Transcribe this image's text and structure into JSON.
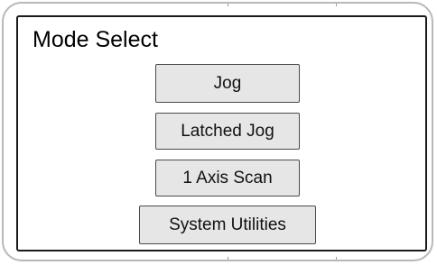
{
  "screen": {
    "title": "Mode Select"
  },
  "buttons": [
    {
      "label": "Jog"
    },
    {
      "label": "Latched Jog"
    },
    {
      "label": "1 Axis Scan"
    },
    {
      "label": "System Utilities"
    }
  ],
  "colors": {
    "button_fill": "#e6e6e6",
    "button_border": "#4a4a4a",
    "screen_border": "#1a1a1a",
    "frame_border": "#b8b8b8"
  }
}
